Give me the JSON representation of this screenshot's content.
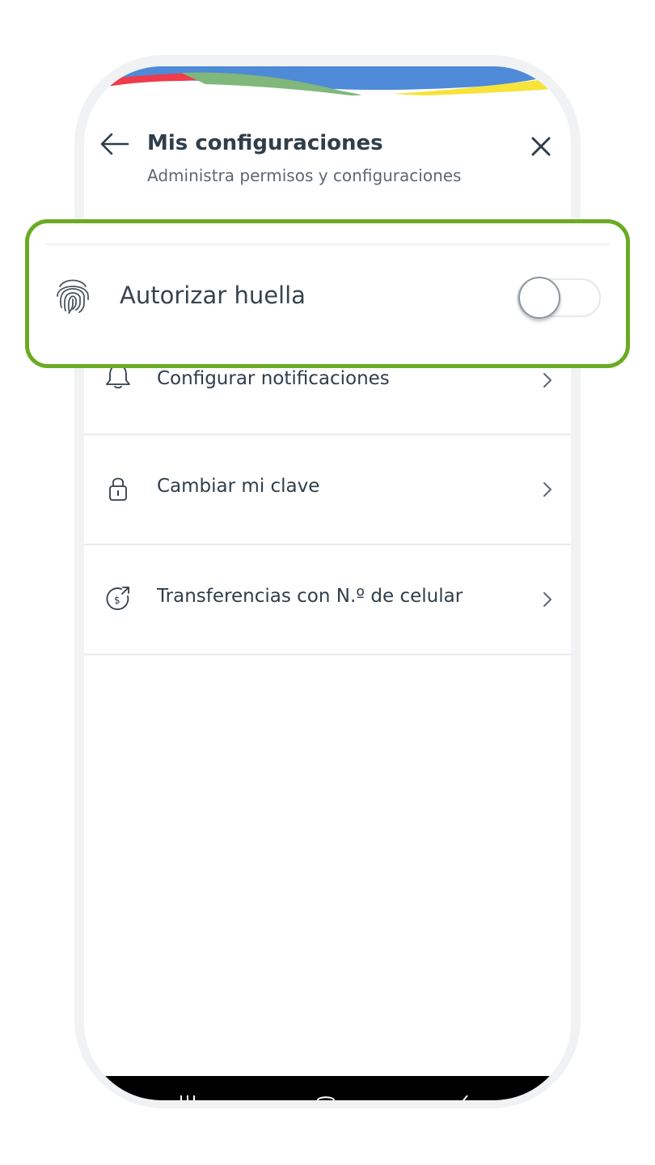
{
  "header": {
    "title": "Mis configuraciones",
    "subtitle": "Administra permisos y configuraciones",
    "back_icon": "arrow-left-icon",
    "close_icon": "close-icon"
  },
  "fingerprint": {
    "label": "Autorizar huella",
    "icon": "fingerprint-icon",
    "enabled": false
  },
  "menu": {
    "items": [
      {
        "label": "Configurar notificaciones",
        "icon": "bell-icon"
      },
      {
        "label": "Cambiar mi clave",
        "icon": "lock-icon"
      },
      {
        "label": "Transferencias con N.º de celular",
        "icon": "money-transfer-icon"
      }
    ]
  },
  "colors": {
    "highlight": "#6aab23",
    "text": "#2f3e4a",
    "wave_blue": "#4f8ad8",
    "wave_red": "#ef3b4a",
    "wave_green": "#7fb87a",
    "wave_yellow": "#f7e33a"
  }
}
